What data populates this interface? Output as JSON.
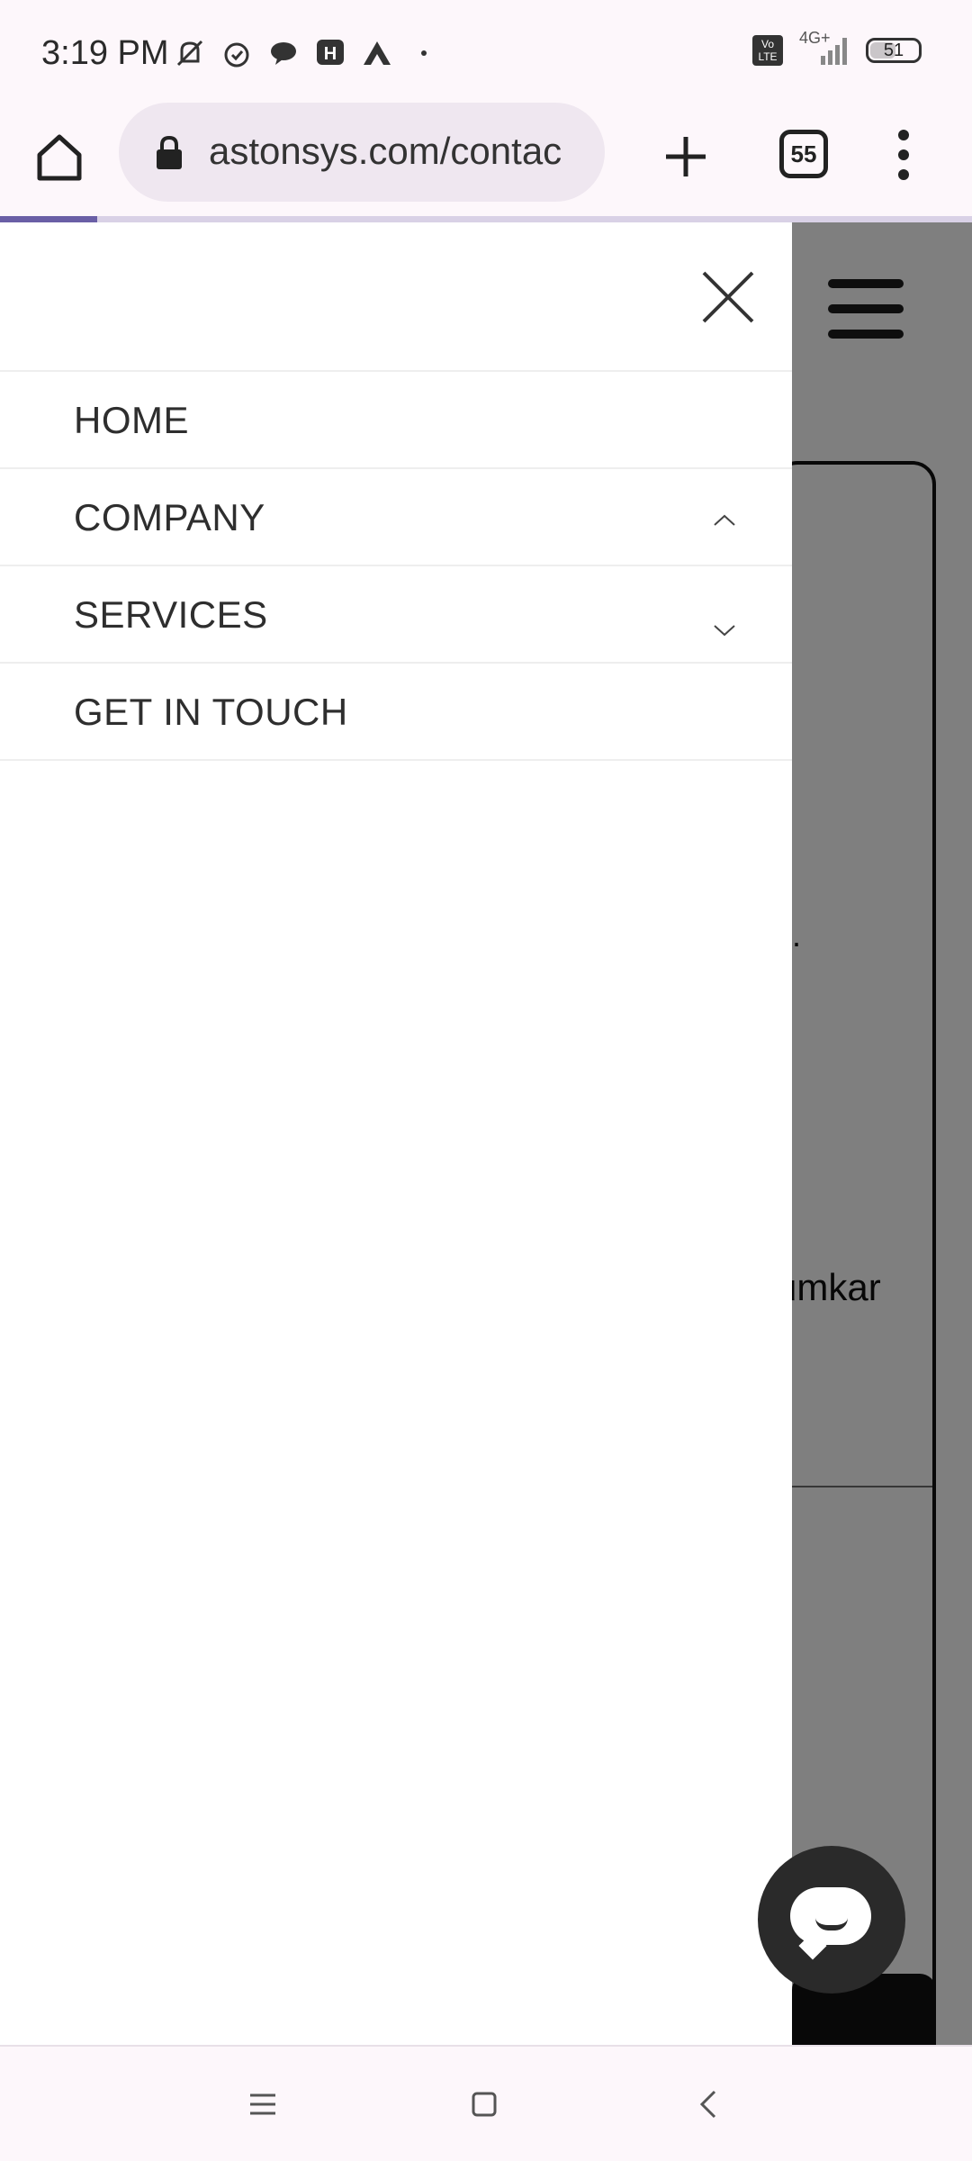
{
  "status_bar": {
    "time": "3:19 PM",
    "network": "4G+",
    "volte": "Vo LTE",
    "battery": "51"
  },
  "browser": {
    "url": "astonsys.com/contac",
    "tab_count": "55"
  },
  "background_page": {
    "partial_text_1": ".",
    "partial_text_2": "umkar"
  },
  "drawer": {
    "items": [
      {
        "label": "HOME",
        "chevron": null
      },
      {
        "label": "COMPANY",
        "chevron": "up"
      },
      {
        "label": "SERVICES",
        "chevron": "down"
      },
      {
        "label": "GET IN TOUCH",
        "chevron": null
      }
    ]
  },
  "colors": {
    "accent": "#6a5fa6",
    "overlay": "#808080",
    "chat_button": "#2a2a2a"
  }
}
